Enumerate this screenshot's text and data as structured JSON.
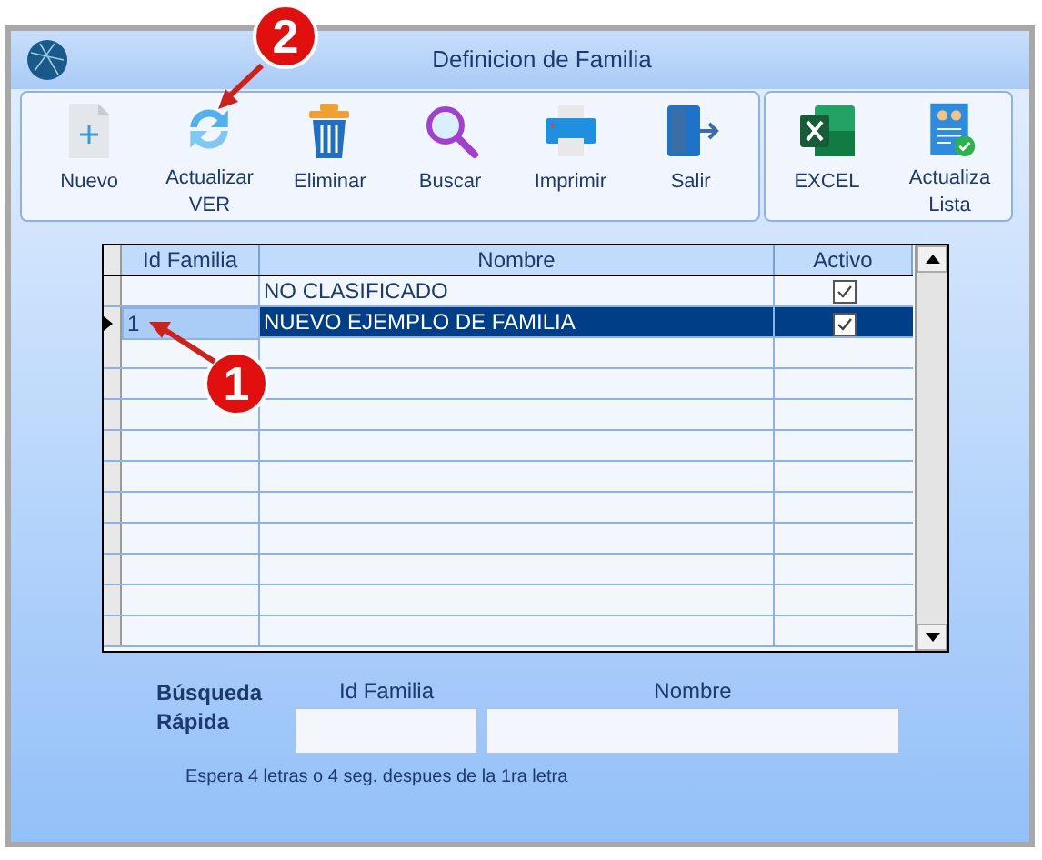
{
  "window": {
    "title": "Definicion de Familia"
  },
  "toolbar": [
    {
      "kind": "new",
      "label": "Nuevo"
    },
    {
      "kind": "refresh",
      "label": "Actualizar VER"
    },
    {
      "kind": "delete",
      "label": "Eliminar"
    },
    {
      "kind": "search",
      "label": "Buscar"
    },
    {
      "kind": "print",
      "label": "Imprimir"
    },
    {
      "kind": "exit",
      "label": "Salir"
    }
  ],
  "toolbar_2": [
    {
      "kind": "excel",
      "label": "EXCEL"
    },
    {
      "kind": "list",
      "label": "Actualiza Lista"
    }
  ],
  "table": {
    "columns": [
      "Id Familia",
      "Nombre",
      "Activo"
    ],
    "rows": [
      {
        "id": "",
        "nombre": "NO CLASIFICADO",
        "activo": true,
        "selected": false
      },
      {
        "id": "1",
        "nombre": "NUEVO EJEMPLO DE FAMILIA",
        "activo": true,
        "selected": true
      }
    ]
  },
  "quick_search": {
    "label": "Búsqueda Rápida",
    "fields": [
      {
        "label": "Id Familia"
      },
      {
        "label": "Nombre"
      }
    ],
    "hint": "Espera 4 letras o 4 seg. despues de la 1ra letra"
  },
  "annotations": [
    {
      "label": "2"
    },
    {
      "label": "1"
    }
  ]
}
